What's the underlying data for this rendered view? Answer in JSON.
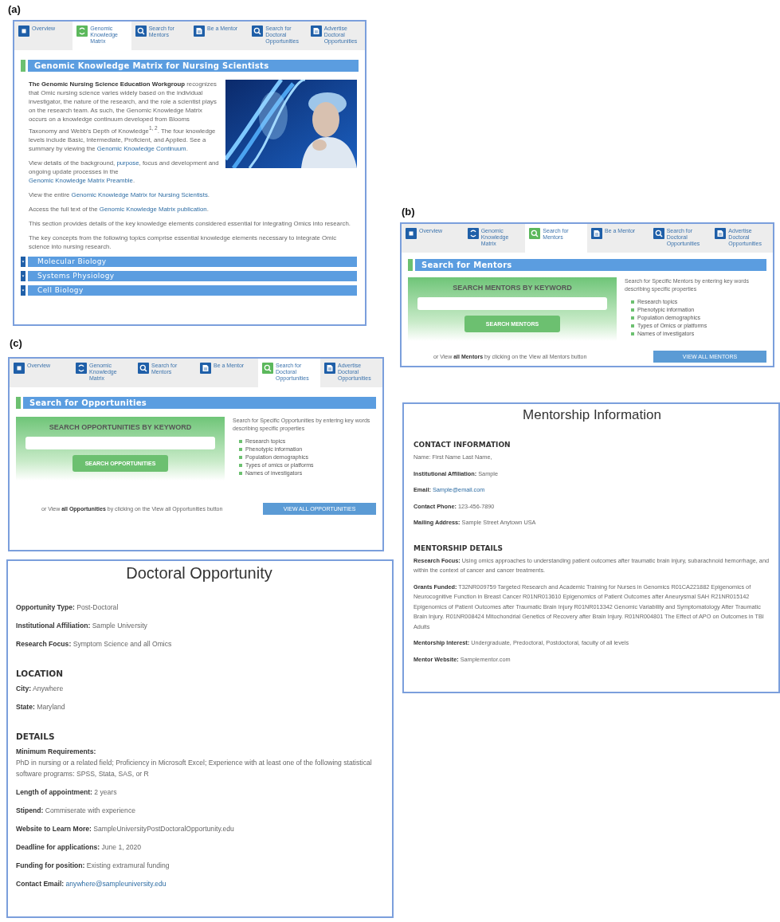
{
  "panel_a": {
    "label": "(a)",
    "tabs": [
      {
        "label": "Overview",
        "kind": "square",
        "selected": false
      },
      {
        "label": "Genomic Knowledge Matrix",
        "kind": "cycle",
        "selected": true
      },
      {
        "label": "Search for Mentors",
        "kind": "search",
        "selected": false
      },
      {
        "label": "Be a Mentor",
        "kind": "document",
        "selected": false
      },
      {
        "label": "Search for Doctoral Opportunities",
        "kind": "search",
        "selected": false
      },
      {
        "label": "Advertise Doctoral Opportunities",
        "kind": "document",
        "selected": false
      }
    ],
    "heading": "Genomic Knowledge Matrix for Nursing Scientists",
    "intro_paragraphs": [
      [
        {
          "text": "**The Genomic Nursing Science Education Workgroup** recognizes that Omic nursing science varies widely based on the individual investigator, the nature of the research, and the role a scientist plays on the research team. As such, the Genomic Knowledge Matrix occurs on a knowledge continuum developed from Blooms Taxonomy and Webb's Depth of Knowledge$^{1, 2}$. The four knowledge levels include Basic, Intermediate, Proficient, and Applied. See a summary by viewing the ",
          "kind": "text"
        },
        {
          "text": "Genomic Knowledge Continuum",
          "kind": "link"
        },
        {
          "text": ".",
          "kind": "text"
        }
      ],
      [
        {
          "text": "View details of the background, ",
          "kind": "text"
        },
        {
          "text": "purpose",
          "kind": "link"
        },
        {
          "text": ", focus and development and ongoing update processes in the ",
          "kind": "text"
        },
        {
          "text": "Genomic Knowledge Matrix Preamble",
          "kind": "link"
        },
        {
          "text": ".",
          "kind": "text"
        }
      ]
    ],
    "paragraphs": [
      [
        {
          "text": "View the entire ",
          "kind": "text"
        },
        {
          "text": "Genomic Knowledge Matrix for Nursing Scientists",
          "kind": "link"
        },
        {
          "text": ".",
          "kind": "text"
        }
      ],
      [
        {
          "text": "Access the full text of the ",
          "kind": "text"
        },
        {
          "text": "Genomic Knowledge Matrix publication",
          "kind": "link"
        },
        {
          "text": ".",
          "kind": "text"
        }
      ],
      [
        {
          "text": "This section provides details of the key knowledge elements considered essential for integrating Omics into research.",
          "kind": "text"
        }
      ],
      [
        {
          "text": "The key concepts from the following topics comprise essential knowledge elements necessary to integrate Omic science into nursing research.",
          "kind": "text"
        }
      ]
    ],
    "accordions": [
      "Molecular Biology",
      "Systems Physiology",
      "Cell Biology"
    ]
  },
  "panel_b": {
    "label": "(b)",
    "tabs": [
      {
        "label": "Overview",
        "kind": "square",
        "selected": false
      },
      {
        "label": "Genomic Knowledge Matrix",
        "kind": "cycle",
        "selected": false
      },
      {
        "label": "Search for Mentors",
        "kind": "search",
        "selected": true
      },
      {
        "label": "Be a Mentor",
        "kind": "document",
        "selected": false
      },
      {
        "label": "Search for Doctoral Opportunities",
        "kind": "search",
        "selected": false
      },
      {
        "label": "Advertise Doctoral Opportunities",
        "kind": "document",
        "selected": false
      }
    ],
    "heading": "Search for Mentors",
    "search_title": "SEARCH MENTORS BY KEYWORD",
    "search_button": "SEARCH MENTORS",
    "description": "Search for Specific Mentors by entering key words describing specific properties",
    "bullets": [
      "Research topics",
      "Phenotypic information",
      "Population demographics",
      "Types of Omics or platforms",
      "Names of investigators"
    ],
    "view_all_text": "or View **all Mentors** by clicking on the View all Mentors button",
    "view_all_button": "VIEW ALL MENTORS"
  },
  "mentorship_info": {
    "title": "Mentorship Information",
    "sections": [
      {
        "heading": "CONTACT INFORMATION",
        "fields": [
          {
            "kind": "plain",
            "value": "Name: First Name Last Name,"
          },
          {
            "kind": "inline",
            "label": "Institutional Affiliation:",
            "value": "Sample"
          },
          {
            "kind": "link",
            "label": "Email:",
            "value": "Sample@email.com"
          },
          {
            "kind": "inline",
            "label": "Contact Phone:",
            "value": "123-456-7890"
          },
          {
            "kind": "inline",
            "label": "Mailing Address:",
            "value": "Sample Street Anytown USA"
          }
        ]
      },
      {
        "heading": "MENTORSHIP DETAILS",
        "fields": [
          {
            "kind": "inline",
            "label": "Research Focus:",
            "value": "Using omics approaches to understanding patient outcomes after traumatic brain injury, subarachnoid hemorrhage, and within the context of cancer and cancer treatments."
          },
          {
            "kind": "inline",
            "label": "Grants Funded:",
            "value": "T32NR009759 Targeted Research and Academic Training for Nurses in Genomics R01CA221882 Epigenomics of Neurocognitive Function in Breast Cancer R01NR013610 Epigenomics of Patient Outcomes after Aneurysmal SAH R21NR015142 Epigenomics of Patient Outcomes after Traumatic Brain Injury R01NR013342 Genomic Variability and Symptomatology After Traumatic Brain Injury. R01NR008424 Mitochondrial Genetics of Recovery after Brain Injury. R01NR004801 The Effect of APO on Outcomes in TBI Adults"
          },
          {
            "kind": "inline",
            "label": "Mentorship Interest:",
            "value": "Undergraduate, Predoctoral, Postdoctoral, faculty of all levels"
          },
          {
            "kind": "inline",
            "label": "Mentor Website:",
            "value": "Samplementor.com"
          }
        ]
      }
    ]
  },
  "panel_c": {
    "label": "(c)",
    "tabs": [
      {
        "label": "Overview",
        "kind": "square",
        "selected": false
      },
      {
        "label": "Genomic Knowledge Matrix",
        "kind": "cycle",
        "selected": false
      },
      {
        "label": "Search for Mentors",
        "kind": "search",
        "selected": false
      },
      {
        "label": "Be a Mentor",
        "kind": "document",
        "selected": false
      },
      {
        "label": "Search for Doctoral Opportunities",
        "kind": "search",
        "selected": true
      },
      {
        "label": "Advertise Doctoral Opportunities",
        "kind": "document",
        "selected": false
      }
    ],
    "heading": "Search for Opportunities",
    "search_title": "SEARCH OPPORTUNITIES BY KEYWORD",
    "search_button": "SEARCH OPPORTUNITIES",
    "description": "Search for Specific Opportunities by entering key words describing specific properties",
    "bullets": [
      "Research topics",
      "Phenotypic information",
      "Population demographics",
      "Types of omics or platforms",
      "Names of investigators"
    ],
    "view_all_text": "or View **all Opportunities** by clicking on the View all Opportunities button",
    "view_all_button": "VIEW ALL OPPORTUNITIES"
  },
  "doctoral_opportunity": {
    "title": "Doctoral Opportunity",
    "sections": [
      {
        "fields": [
          {
            "kind": "inline",
            "label": "Opportunity Type:",
            "value": "Post-Doctoral"
          },
          {
            "kind": "inline",
            "label": "Institutional Affiliation:",
            "value": "Sample University"
          },
          {
            "kind": "inline",
            "label": "Research Focus:",
            "value": "Symptom Science and all Omics"
          }
        ]
      },
      {
        "heading": "LOCATION",
        "fields": [
          {
            "kind": "inline",
            "label": "City:",
            "value": "Anywhere"
          },
          {
            "kind": "inline",
            "label": "State:",
            "value": "Maryland"
          }
        ]
      },
      {
        "heading": "DETAILS",
        "fields": [
          {
            "kind": "stacked",
            "label": "Minimum Requirements:",
            "value": "PhD in nursing or a related field; Proficiency in Microsoft Excel; Experience with at least one of the following statistical software programs: SPSS, Stata, SAS, or R"
          },
          {
            "kind": "inline",
            "label": "Length of appointment:",
            "value": "2 years"
          },
          {
            "kind": "inline",
            "label": "Stipend:",
            "value": "Commiserate with experience"
          },
          {
            "kind": "inline",
            "label": "Website to Learn More:",
            "value": "SampleUniversityPostDoctoralOpportunity.edu"
          },
          {
            "kind": "inline",
            "label": "Deadline for applications:",
            "value": "June 1, 2020"
          },
          {
            "kind": "inline",
            "label": "Funding for position:",
            "value": "Existing extramural funding"
          },
          {
            "kind": "link",
            "label": "Contact Email:",
            "value": "anywhere@sampleuniversity.edu"
          }
        ]
      }
    ]
  }
}
